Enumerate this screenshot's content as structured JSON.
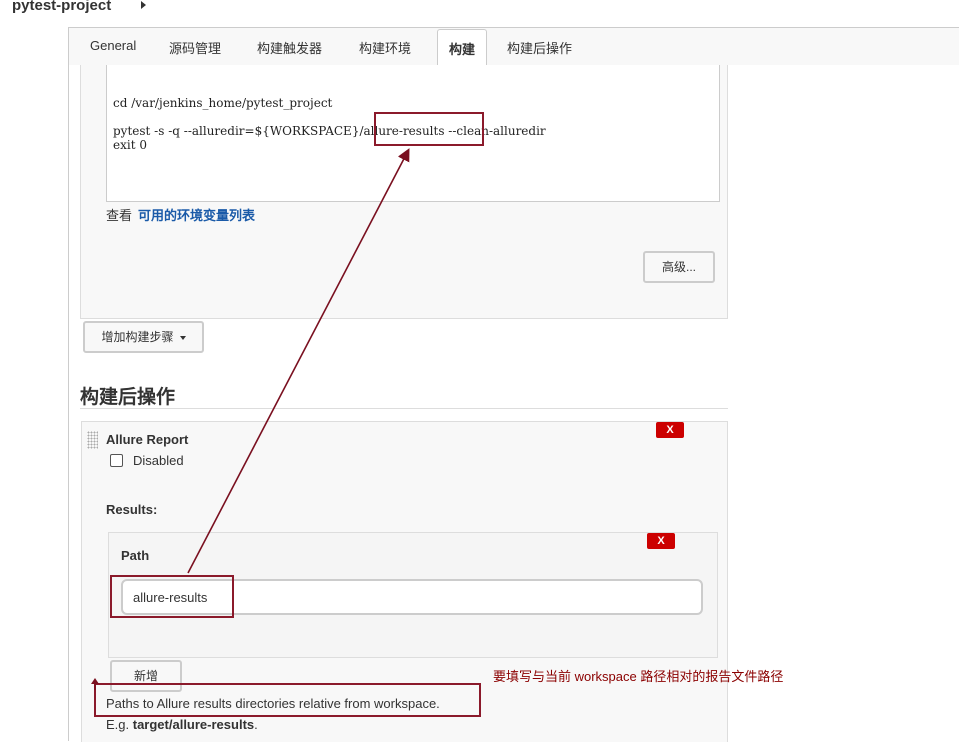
{
  "breadcrumb": {
    "project": "pytest-project"
  },
  "tabs": [
    "General",
    "源码管理",
    "构建触发器",
    "构建环境",
    "构建",
    "构建后操作"
  ],
  "build": {
    "code_lines": [
      "cd /var/jenkins_home/pytest_project",
      "pytest -s -q --alluredir=${WORKSPACE}/allure-results --clean-alluredir",
      "exit 0"
    ],
    "env_prefix": "查看",
    "env_link": "可用的环境变量列表",
    "advanced_button": "高级...",
    "add_step_button": "增加构建步骤"
  },
  "post_build": {
    "section_title": "构建后操作",
    "allure": {
      "title": "Allure Report",
      "disabled_label": "Disabled",
      "disabled_checked": false,
      "delete_label": "X",
      "results_label": "Results:",
      "path_label": "Path",
      "path_value": "allure-results",
      "path_delete_label": "X",
      "add_button": "新增",
      "help_line1": "Paths to Allure results directories relative from workspace.",
      "help_prefix": "E.g. ",
      "help_example": "target/allure-results",
      "help_suffix": "."
    }
  },
  "annotation": {
    "note": "要填写与当前 workspace 路径相对的报告文件路径",
    "color": "#8b0000"
  }
}
